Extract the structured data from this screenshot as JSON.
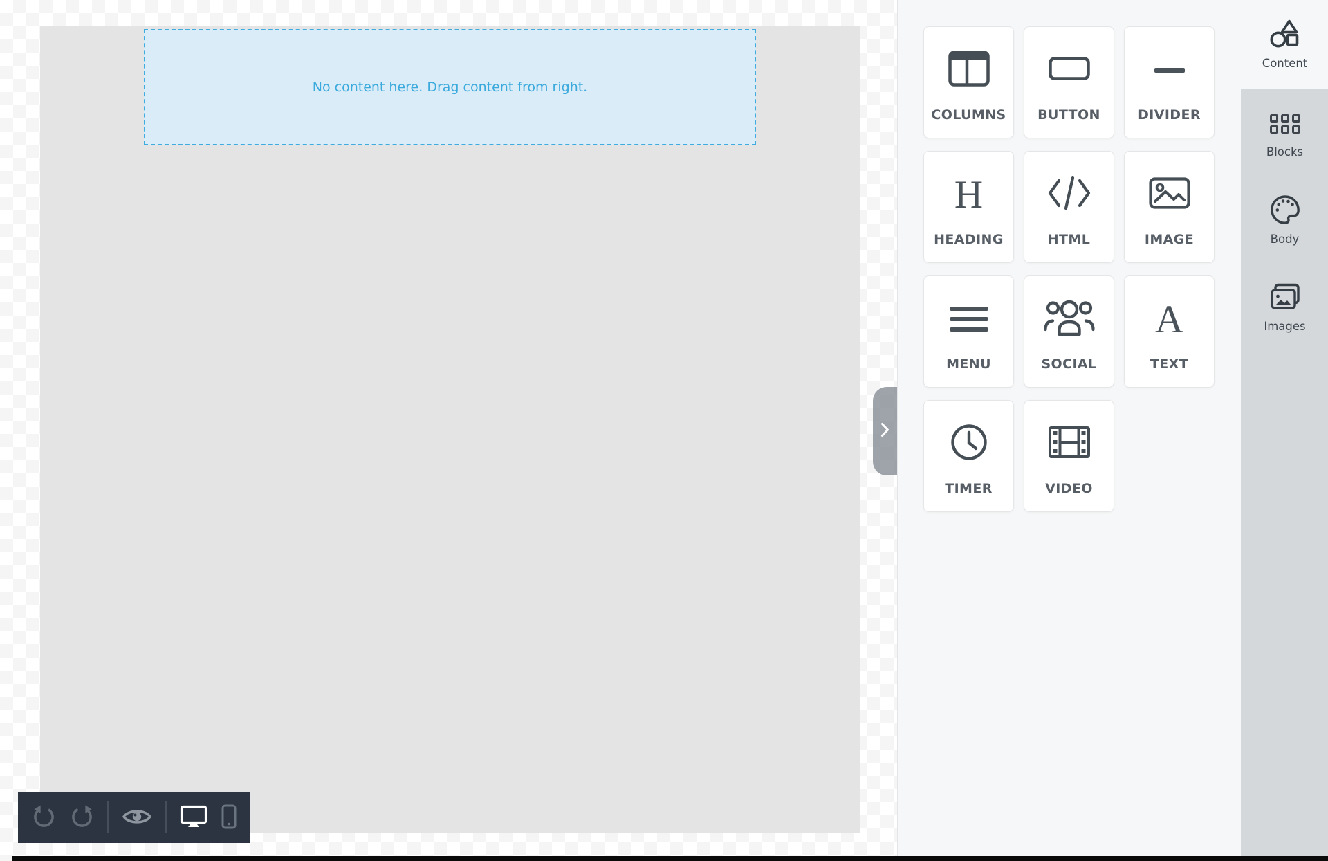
{
  "canvas": {
    "dropzone_text": "No content here. Drag content from right."
  },
  "panel": {
    "tiles": [
      {
        "label": "COLUMNS",
        "icon": "columns-icon"
      },
      {
        "label": "BUTTON",
        "icon": "button-icon"
      },
      {
        "label": "DIVIDER",
        "icon": "divider-icon"
      },
      {
        "label": "HEADING",
        "icon": "heading-icon"
      },
      {
        "label": "HTML",
        "icon": "html-icon"
      },
      {
        "label": "IMAGE",
        "icon": "image-icon"
      },
      {
        "label": "MENU",
        "icon": "menu-icon"
      },
      {
        "label": "SOCIAL",
        "icon": "social-icon"
      },
      {
        "label": "TEXT",
        "icon": "text-icon"
      },
      {
        "label": "TIMER",
        "icon": "timer-icon"
      },
      {
        "label": "VIDEO",
        "icon": "video-icon"
      }
    ]
  },
  "sidebar": {
    "tabs": [
      {
        "label": "Content",
        "icon": "content-icon",
        "active": true
      },
      {
        "label": "Blocks",
        "icon": "blocks-icon",
        "active": false
      },
      {
        "label": "Body",
        "icon": "body-icon",
        "active": false
      },
      {
        "label": "Images",
        "icon": "images-icon",
        "active": false
      }
    ]
  },
  "toolbar": {
    "buttons": [
      {
        "name": "undo",
        "icon": "undo-icon",
        "active": false
      },
      {
        "name": "redo",
        "icon": "redo-icon",
        "active": false
      },
      {
        "name": "separator"
      },
      {
        "name": "preview",
        "icon": "eye-icon",
        "active": false
      },
      {
        "name": "separator"
      },
      {
        "name": "desktop",
        "icon": "desktop-icon",
        "active": true
      },
      {
        "name": "mobile",
        "icon": "mobile-icon",
        "active": false
      }
    ]
  },
  "collapse_handle": {
    "icon": "chevron-right-icon"
  },
  "colors": {
    "accent_blue": "#3aabdf",
    "dropzone_bg": "#d9ecf8",
    "canvas_body_bg": "#e4e4e4",
    "toolbar_bg": "#2b3440",
    "panel_bg": "#f6f7f8",
    "tab_strip_bg": "#d5d8db",
    "tile_icon_color": "#454d55",
    "active_device_color": "#ffffff"
  }
}
